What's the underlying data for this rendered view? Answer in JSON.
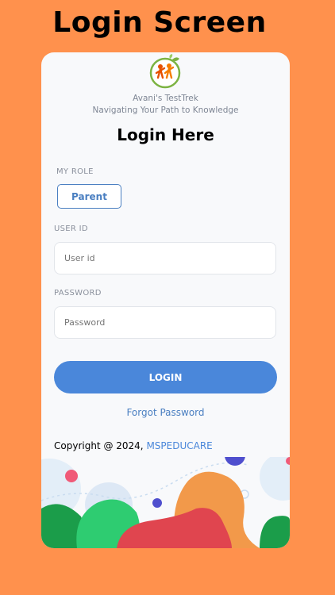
{
  "page": {
    "heading": "Login Screen"
  },
  "card": {
    "brand_name": "Avani's TestTrek",
    "tagline": "Navigating Your Path to Knowledge",
    "title": "Login Here",
    "role_label": "MY ROLE",
    "role_value": "Parent",
    "user_id_label": "USER ID",
    "user_id_placeholder": "User id",
    "password_label": "PASSWORD",
    "password_placeholder": "Password",
    "login_button": "LOGIN",
    "forgot_password": "Forgot Password",
    "copyright_prefix": "Copyright @ 2024, ",
    "copyright_brand": "MSPEDUCARE"
  },
  "colors": {
    "background": "#FF914D",
    "accent": "#4A87DA",
    "card": "#F8F9FB"
  }
}
